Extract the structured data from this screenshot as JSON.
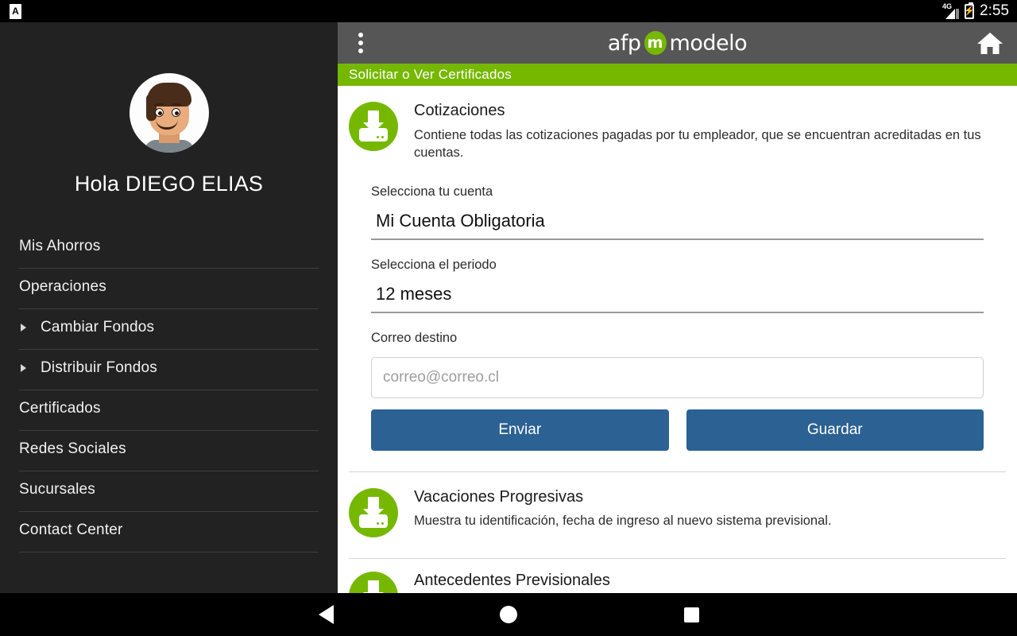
{
  "status_bar": {
    "notification_icon": "app-notification-icon",
    "notification_letter": "A",
    "network_type": "4G",
    "battery_icon": "battery-charging-icon",
    "time": "2:55"
  },
  "sidebar": {
    "avatar_name": "user-avatar-illustration",
    "greeting": "Hola DIEGO ELIAS",
    "items": [
      {
        "label": "Mis Ahorros",
        "sub": false
      },
      {
        "label": "Operaciones",
        "sub": false
      },
      {
        "label": "Cambiar Fondos",
        "sub": true
      },
      {
        "label": "Distribuir Fondos",
        "sub": true
      },
      {
        "label": "Certificados",
        "sub": false
      },
      {
        "label": "Redes Sociales",
        "sub": false
      },
      {
        "label": "Sucursales",
        "sub": false
      },
      {
        "label": "Contact Center",
        "sub": false
      }
    ]
  },
  "appbar": {
    "overflow_icon": "overflow-menu-icon",
    "home_icon": "home-icon",
    "logo_prefix": "afp",
    "logo_mark": "m",
    "logo_suffix": "modelo"
  },
  "page_title": "Solicitar o Ver Certificados",
  "certificates": [
    {
      "icon": "download-icon",
      "title": "Cotizaciones",
      "description": "Contiene todas las cotizaciones pagadas por tu empleador, que se encuentran acreditadas en tus cuentas."
    },
    {
      "icon": "download-icon",
      "title": "Vacaciones Progresivas",
      "description": "Muestra tu identificación, fecha de ingreso al nuevo sistema previsional."
    },
    {
      "icon": "download-icon",
      "title": "Antecedentes Previsionales",
      "description": ""
    }
  ],
  "form": {
    "account_label": "Selecciona tu cuenta",
    "account_value": "Mi Cuenta Obligatoria",
    "period_label": "Selecciona el periodo",
    "period_value": "12 meses",
    "email_label": "Correo destino",
    "email_value": "",
    "email_placeholder": "correo@correo.cl",
    "send_button": "Enviar",
    "save_button": "Guardar"
  },
  "nav_bar": {
    "back_icon": "back-triangle-icon",
    "home_icon": "home-circle-icon",
    "recents_icon": "recents-square-icon"
  },
  "colors": {
    "brand_green": "#76b800",
    "button_blue": "#2b6193",
    "appbar_gray": "#565656",
    "sidebar_bg": "#222222"
  }
}
